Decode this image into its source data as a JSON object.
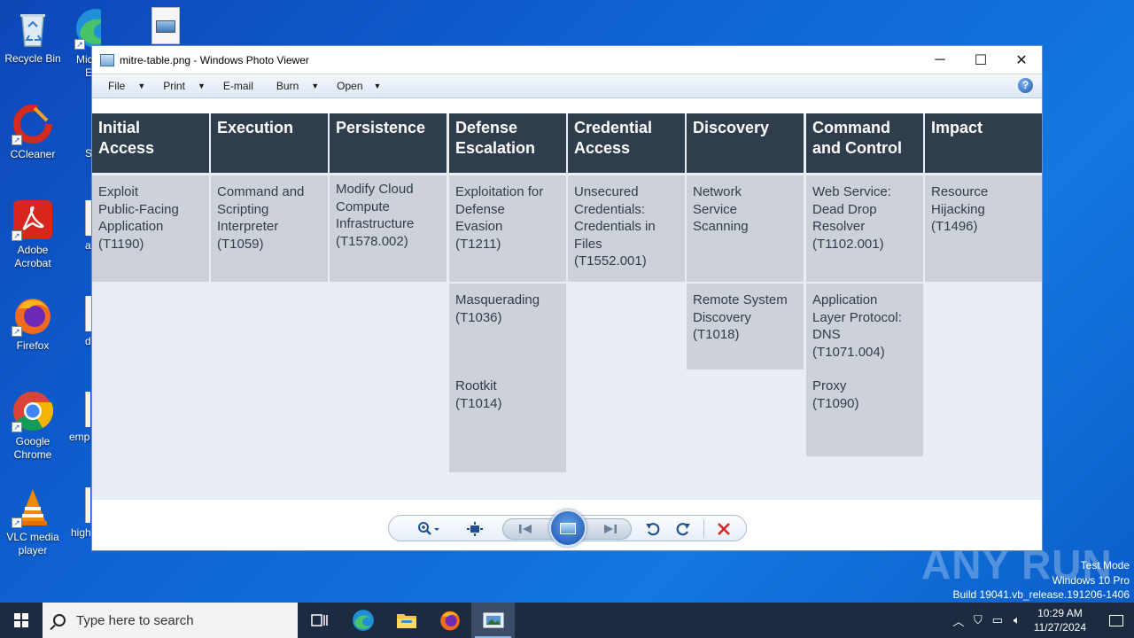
{
  "desktop": {
    "icons": [
      {
        "label": "Recycle Bin"
      },
      {
        "label": "CCleaner"
      },
      {
        "label": "Adobe Acrobat"
      },
      {
        "label": "Firefox"
      },
      {
        "label": "Google Chrome"
      },
      {
        "label": "VLC media player"
      }
    ],
    "partial_labels": [
      "Mic",
      "Ed",
      "S",
      "avail",
      "disc",
      "emp",
      "high"
    ]
  },
  "window": {
    "title": "mitre-table.png - Windows Photo Viewer",
    "controls": {
      "minimize": "─",
      "maximize": "☐",
      "close": "✕"
    },
    "menu": [
      {
        "label": "File",
        "has_dropdown": true
      },
      {
        "label": "Print",
        "has_dropdown": true
      },
      {
        "label": "E-mail",
        "has_dropdown": false
      },
      {
        "label": "Burn",
        "has_dropdown": true
      },
      {
        "label": "Open",
        "has_dropdown": true
      }
    ],
    "help": "?"
  },
  "mitre_table": {
    "columns": [
      {
        "header": [
          "Initial",
          "Access"
        ],
        "cells": [
          [
            "Exploit",
            "Public-Facing",
            "Application",
            "(T1190)"
          ]
        ]
      },
      {
        "header": [
          "Execution"
        ],
        "cells": [
          [
            "Command and",
            "Scripting",
            "Interpreter",
            "(T1059)"
          ]
        ]
      },
      {
        "header": [
          "Persistence"
        ],
        "cells": [
          [
            "Modify Cloud",
            "Compute",
            "Infrastructure",
            "(T1578.002)"
          ]
        ]
      },
      {
        "header": [
          "Defense",
          "Escalation"
        ],
        "cells": [
          [
            "Exploitation for",
            "Defense",
            "Evasion",
            "(T1211)"
          ],
          [
            "Masquerading",
            "(T1036)"
          ],
          [
            "Rootkit",
            "(T1014)"
          ]
        ]
      },
      {
        "header": [
          "Credential",
          "Access"
        ],
        "cells": [
          [
            "Unsecured",
            "Credentials:",
            "Credentials in",
            "Files",
            "(T1552.001)"
          ]
        ]
      },
      {
        "header": [
          "Discovery"
        ],
        "cells": [
          [
            "Network",
            "Service",
            "Scanning"
          ],
          [
            "Remote System",
            "Discovery",
            "(T1018)"
          ]
        ]
      },
      {
        "header": [
          "Command",
          "and Control"
        ],
        "cells": [
          [
            "Web Service:",
            "Dead Drop",
            "Resolver",
            "(T1102.001)"
          ],
          [
            "Application",
            "Layer Protocol:",
            "DNS",
            "(T1071.004)"
          ],
          [
            "Proxy",
            "(T1090)"
          ]
        ]
      },
      {
        "header": [
          "Impact"
        ],
        "cells": [
          [
            "Resource",
            "Hijacking",
            "(T1496)"
          ]
        ]
      }
    ]
  },
  "toolbar": {
    "zoom_icon": "zoom-icon",
    "fit_icon": "actual-size-icon",
    "prev_icon": "previous-icon",
    "slideshow_icon": "slideshow-icon",
    "next_icon": "next-icon",
    "rotate_ccw_icon": "rotate-counterclockwise-icon",
    "rotate_cw_icon": "rotate-clockwise-icon",
    "delete_icon": "delete-icon"
  },
  "watermark": {
    "brand": "ANY RUN",
    "lines": [
      "Test Mode",
      "Windows 10 Pro",
      "Build 19041.vb_release.191206-1406"
    ]
  },
  "taskbar": {
    "search_placeholder": "Type here to search",
    "time": "10:29 AM",
    "date": "11/27/2024"
  }
}
